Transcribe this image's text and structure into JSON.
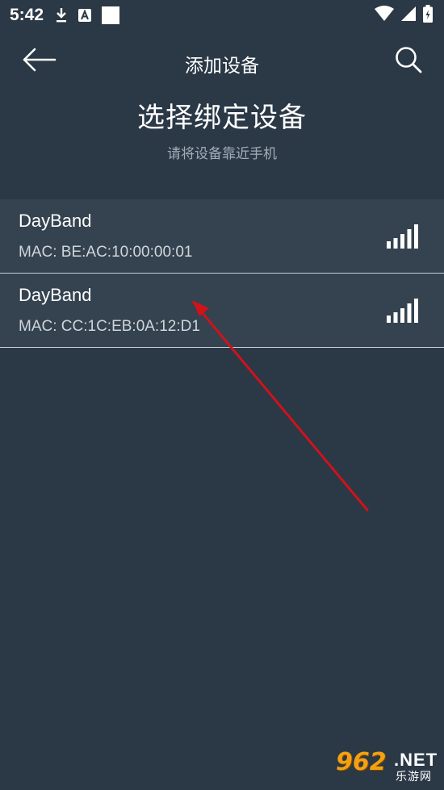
{
  "status_bar": {
    "time": "5:42",
    "left_icons": [
      "download-icon",
      "keyboard-a-icon",
      "square-icon"
    ],
    "right_icons": [
      "wifi-icon",
      "cellular-icon",
      "battery-icon"
    ]
  },
  "header": {
    "title": "添加设备",
    "back_icon": "arrow-left-icon",
    "search_icon": "search-icon"
  },
  "page": {
    "heading": "选择绑定设备",
    "subheading": "请将设备靠近手机"
  },
  "devices": [
    {
      "name": "DayBand",
      "mac": "MAC: BE:AC:10:00:00:01",
      "signal_bars": 5
    },
    {
      "name": "DayBand",
      "mac": "MAC: CC:1C:EB:0A:12:D1",
      "signal_bars": 5
    }
  ],
  "watermark": {
    "logo": "962",
    "net": ".NET",
    "sub": "乐游网"
  },
  "colors": {
    "background": "#2b3846",
    "list_item": "#34434f",
    "divider": "#c9d0d6",
    "annotation_arrow": "#d0121b"
  }
}
